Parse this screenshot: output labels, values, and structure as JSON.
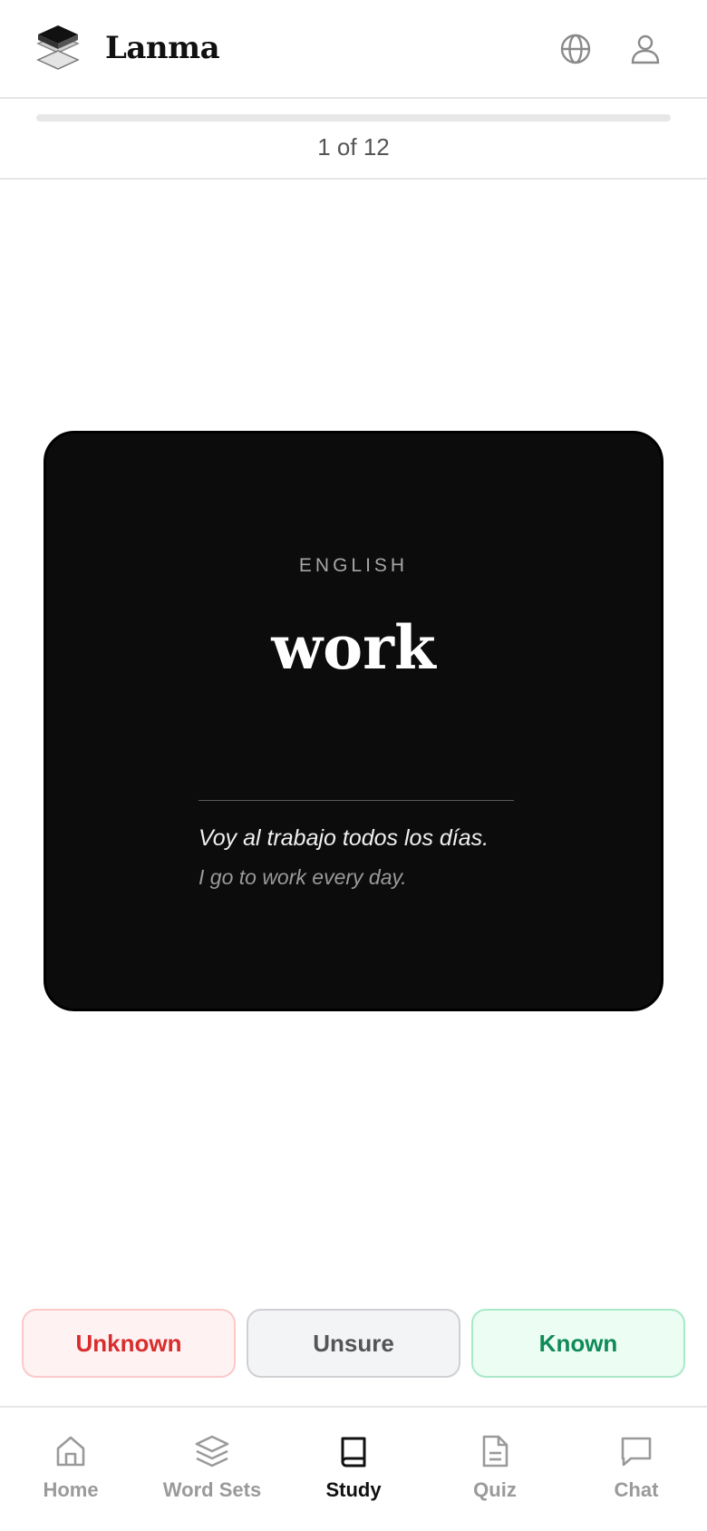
{
  "app": {
    "brand": "Lanma",
    "logo_icon": "stacked-books-icon",
    "header_icons": [
      "globe-icon",
      "user-icon"
    ]
  },
  "progress": {
    "counter": "1 of 12",
    "current": 1,
    "total": 12,
    "fill_fraction": 0.0
  },
  "card": {
    "language": "ENGLISH",
    "word": "work",
    "example": "Voy al trabajo todos los días.",
    "translation": "I go to work every day."
  },
  "actions": {
    "unknown": "Unknown",
    "unsure": "Unsure",
    "known": "Known"
  },
  "nav": {
    "items": [
      {
        "label": "Home",
        "icon": "home-icon"
      },
      {
        "label": "Word Sets",
        "icon": "layers-icon"
      },
      {
        "label": "Study",
        "icon": "book-icon",
        "active": true
      },
      {
        "label": "Quiz",
        "icon": "document-icon"
      },
      {
        "label": "Chat",
        "icon": "chat-bubble-icon"
      }
    ]
  },
  "colors": {
    "card_bg": "#0c0c0c",
    "unknown": "#d92d2d",
    "known": "#108a57",
    "muted": "#9a9a9a"
  }
}
